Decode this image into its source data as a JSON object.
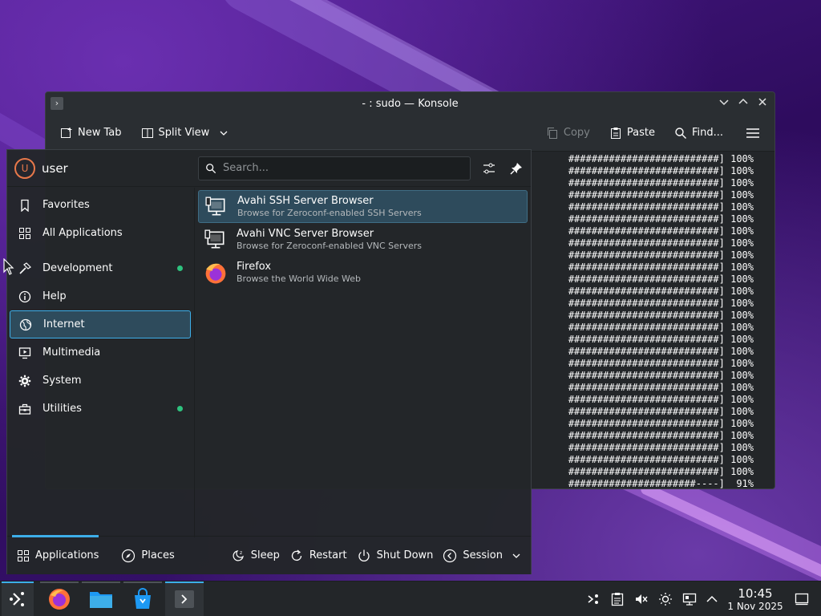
{
  "konsole": {
    "title": "- : sudo — Konsole",
    "toolbar": {
      "new_tab": "New Tab",
      "split_view": "Split View",
      "copy": "Copy",
      "paste": "Paste",
      "find": "Find..."
    },
    "terminal_lines": [
      "##########################] 100%",
      "##########################] 100%",
      "##########################] 100%",
      "##########################] 100%",
      "##########################] 100%",
      "##########################] 100%",
      "##########################] 100%",
      "##########################] 100%",
      "##########################] 100%",
      "##########################] 100%",
      "##########################] 100%",
      "##########################] 100%",
      "##########################] 100%",
      "##########################] 100%",
      "##########################] 100%",
      "##########################] 100%",
      "##########################] 100%",
      "##########################] 100%",
      "##########################] 100%",
      "##########################] 100%",
      "##########################] 100%",
      "##########################] 100%",
      "##########################] 100%",
      "##########################] 100%",
      "##########################] 100%",
      "##########################] 100%",
      "##########################] 100%",
      "######################----]  91%"
    ]
  },
  "launcher": {
    "avatar_initial": "U",
    "username": "user",
    "search_placeholder": "Search...",
    "categories": [
      {
        "label": "Favorites",
        "icon": "bookmark-icon",
        "selected": false,
        "new": false
      },
      {
        "label": "All Applications",
        "icon": "grid-icon",
        "selected": false,
        "new": false
      },
      {
        "label": "Development",
        "icon": "hammer-icon",
        "selected": false,
        "new": true
      },
      {
        "label": "Help",
        "icon": "info-icon",
        "selected": false,
        "new": false
      },
      {
        "label": "Internet",
        "icon": "globe-icon",
        "selected": true,
        "new": false
      },
      {
        "label": "Multimedia",
        "icon": "monitor-play-icon",
        "selected": false,
        "new": false
      },
      {
        "label": "System",
        "icon": "gear-icon",
        "selected": false,
        "new": false
      },
      {
        "label": "Utilities",
        "icon": "toolbox-icon",
        "selected": false,
        "new": true
      }
    ],
    "apps": [
      {
        "name": "Avahi SSH Server Browser",
        "description": "Browse for Zeroconf-enabled SSH Servers",
        "icon": "network-computer-icon",
        "selected": true
      },
      {
        "name": "Avahi VNC Server Browser",
        "description": "Browse for Zeroconf-enabled VNC Servers",
        "icon": "network-computer-icon",
        "selected": false
      },
      {
        "name": "Firefox",
        "description": "Browse the World Wide Web",
        "icon": "firefox-icon",
        "selected": false
      }
    ],
    "bottom": {
      "applications": "Applications",
      "places": "Places",
      "sleep": "Sleep",
      "restart": "Restart",
      "shut_down": "Shut Down",
      "session": "Session"
    }
  },
  "taskbar": {
    "clock_time": "10:45",
    "clock_date": "1 Nov 2025"
  },
  "colors": {
    "accent": "#3daee9",
    "panel": "#232629",
    "new_dot": "#2ec27e"
  }
}
